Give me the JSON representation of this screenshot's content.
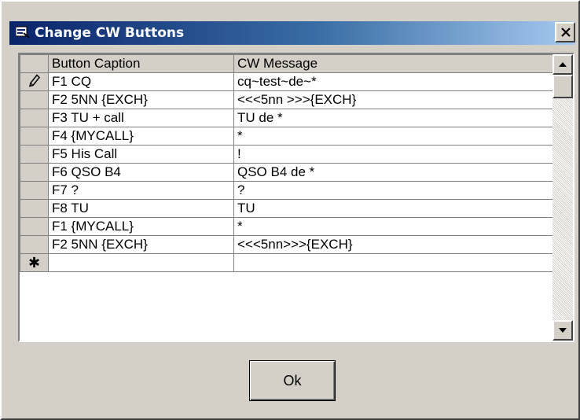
{
  "window": {
    "title": "Change CW Buttons",
    "close_symbol": "×"
  },
  "grid": {
    "columns": [
      "Button Caption",
      "CW Message"
    ],
    "rows": [
      {
        "marker": "pencil-icon",
        "caption": "F1 CQ",
        "message": "cq~test~de~*"
      },
      {
        "marker": "",
        "caption": "F2 5NN {EXCH}",
        "message": "<<<5nn >>>{EXCH}"
      },
      {
        "marker": "",
        "caption": "F3 TU + call",
        "message": "TU de *"
      },
      {
        "marker": "",
        "caption": "F4 {MYCALL}",
        "message": "*"
      },
      {
        "marker": "",
        "caption": "F5 His Call",
        "message": "!"
      },
      {
        "marker": "",
        "caption": "F6 QSO B4",
        "message": "QSO B4 de *"
      },
      {
        "marker": "",
        "caption": "F7 ?",
        "message": "?"
      },
      {
        "marker": "",
        "caption": "F8 TU",
        "message": "TU"
      },
      {
        "marker": "",
        "caption": "F1 {MYCALL}",
        "message": "*"
      },
      {
        "marker": "",
        "caption": "F2 5NN {EXCH}",
        "message": "<<<5nn>>>{EXCH}"
      }
    ],
    "new_row_marker": "✱"
  },
  "buttons": {
    "ok_label": "Ok"
  },
  "colors": {
    "title_gradient_start": "#0a246a",
    "title_gradient_end": "#a6caf0",
    "face": "#d4d0c8"
  }
}
